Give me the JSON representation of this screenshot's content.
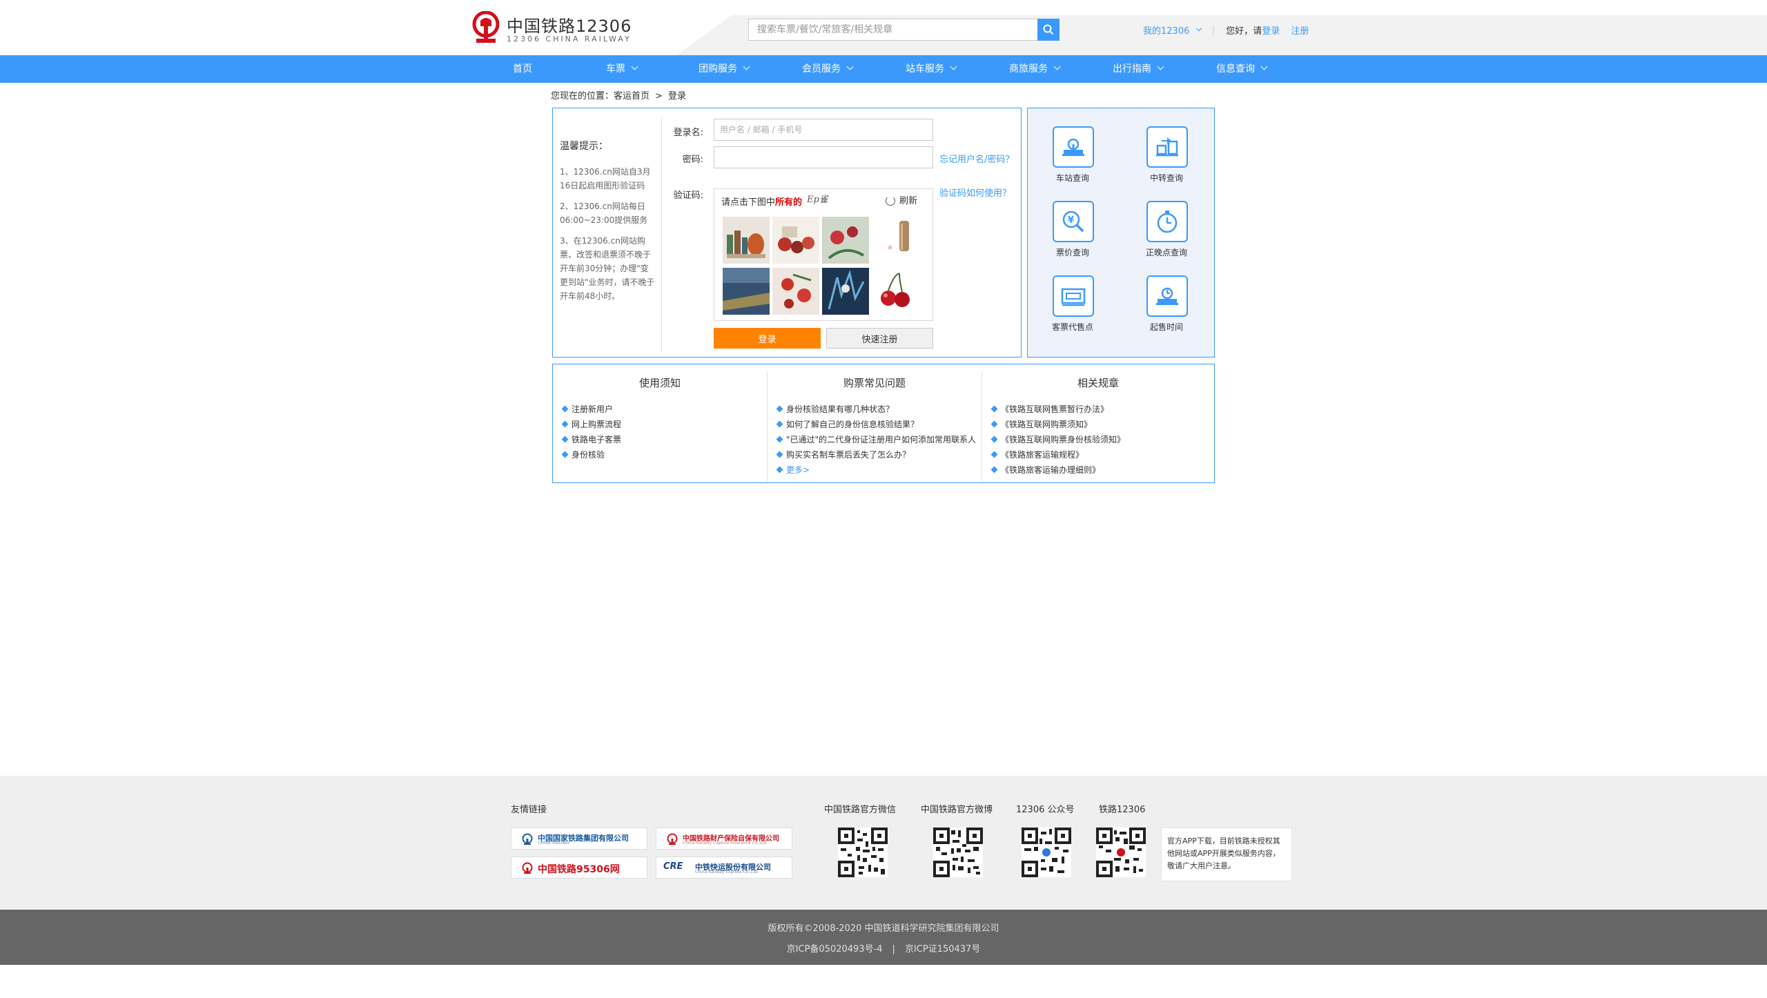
{
  "header": {
    "logo_cn": "中国铁路12306",
    "logo_en": "12306 CHINA RAILWAY",
    "search_placeholder": "搜索车票/餐饮/常旅客/相关规章",
    "my12306": "我的12306",
    "greeting": "您好，请",
    "login": "登录",
    "register": "注册"
  },
  "nav": [
    {
      "label": "首页",
      "dropdown": false
    },
    {
      "label": "车票",
      "dropdown": true
    },
    {
      "label": "团购服务",
      "dropdown": true
    },
    {
      "label": "会员服务",
      "dropdown": true
    },
    {
      "label": "站车服务",
      "dropdown": true
    },
    {
      "label": "商旅服务",
      "dropdown": true
    },
    {
      "label": "出行指南",
      "dropdown": true
    },
    {
      "label": "信息查询",
      "dropdown": true
    }
  ],
  "breadcrumb": {
    "prefix": "您现在的位置：",
    "home": "客运首页",
    "separator": ">",
    "current": "登录"
  },
  "tips": {
    "title": "温馨提示：",
    "items": [
      "1、12306.cn网站自3月16日起启用图形验证码",
      "2、12306.cn网站每日06:00~23:00提供服务",
      "3、在12306.cn网站购票、改签和退票须不晚于开车前30分钟；办理\"变更到站\"业务时，请不晚于开车前48小时。"
    ]
  },
  "form": {
    "username_label": "登录名:",
    "username_placeholder": "用户名 / 邮箱 / 手机号",
    "password_label": "密码:",
    "password_placeholder": "",
    "forgot_link": "忘记用户名/密码？",
    "captcha_label": "验证码:",
    "captcha_help_link": "验证码如何使用？",
    "captcha_prompt_prefix": "请点击下图中",
    "captcha_prompt_bold": "所有的",
    "captcha_target": "Ep雀",
    "refresh": "刷新",
    "login_button": "登录",
    "register_button": "快速注册"
  },
  "services": [
    {
      "label": "车站查询",
      "icon": "station-icon"
    },
    {
      "label": "中转查询",
      "icon": "transfer-icon"
    },
    {
      "label": "票价查询",
      "icon": "price-icon"
    },
    {
      "label": "正晚点查询",
      "icon": "clock-icon"
    },
    {
      "label": "客票代售点",
      "icon": "ticket-agent-icon"
    },
    {
      "label": "起售时间",
      "icon": "sale-time-icon"
    }
  ],
  "notice": {
    "usage": {
      "title": "使用须知",
      "items": [
        "注册新用户",
        "网上购票流程",
        "铁路电子客票",
        "身份核验"
      ]
    },
    "faq": {
      "title": "购票常见问题",
      "items": [
        "身份核验结果有哪几种状态？",
        "如何了解自己的身份信息核验结果？",
        "\"已通过\"的二代身份证注册用户如何添加常用联系人",
        "购买实名制车票后丢失了怎么办？"
      ],
      "more": "更多>"
    },
    "rules": {
      "title": "相关规章",
      "items": [
        "《铁路互联网售票暂行办法》",
        "《铁路互联网购票须知》",
        "《铁路互联网购票身份核验须知》",
        "《铁路旅客运输规程》",
        "《铁路旅客运输办理细则》"
      ]
    }
  },
  "footer": {
    "friends_title": "友情链接",
    "friends": [
      {
        "name": "中国国家铁路集团有限公司",
        "sub": "CHINA RAILWAY"
      },
      {
        "name": "中国铁路财产保险自保有限公司",
        "sub": "China Railway Captive Insurance Co.,Ltd"
      },
      {
        "name": "中国铁路95306网",
        "sub": ""
      },
      {
        "name": "中铁快运股份有限公司",
        "sub": "China Railway Express Co.,Ltd."
      }
    ],
    "qr_titles": [
      "中国铁路官方微信",
      "中国铁路官方微博",
      "12306 公众号",
      "铁路12306"
    ],
    "app_note": "官方APP下载，目前铁路未授权其他网站或APP开展类似服务内容，敬请广大用户注意。",
    "copyright": "版权所有©2008-2020    中国铁道科学研究院集团有限公司",
    "icp1": "京ICP备05020493号-4",
    "icp_sep": "|",
    "icp2": "京ICP证150437号"
  },
  "colors": {
    "primary": "#3b99fc",
    "orange": "#ff8200",
    "logo_red": "#d1101c",
    "footer_dark": "#666666"
  }
}
